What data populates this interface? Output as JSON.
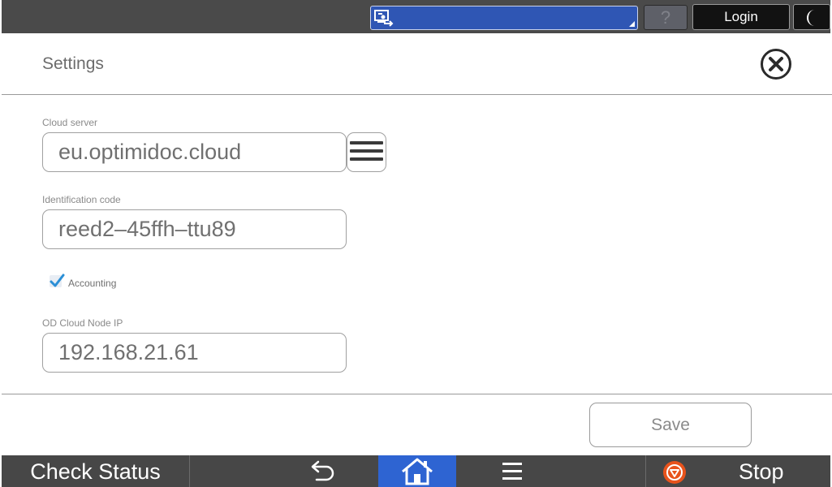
{
  "topbar": {
    "job_selector_icon": "device-transfer-icon",
    "help_label": "?",
    "login_label": "Login",
    "sleep_icon": "moon-icon"
  },
  "header": {
    "title": "Settings",
    "close_icon": "close-circle-icon"
  },
  "form": {
    "cloud_server": {
      "label": "Cloud server",
      "value": "eu.optimidoc.cloud",
      "menu_icon": "hamburger-menu-icon"
    },
    "identification_code": {
      "label": "Identification code",
      "value": "reed2–45ffh–ttu89"
    },
    "accounting": {
      "label": "Accounting",
      "checked": true
    },
    "node_ip": {
      "label": "OD Cloud Node IP",
      "value": "192.168.21.61"
    },
    "save_label": "Save"
  },
  "bottombar": {
    "check_status_label": "Check Status",
    "back_icon": "back-arrow-icon",
    "home_icon": "home-icon",
    "menu_icon": "menu-icon",
    "stop_icon": "stop-icon",
    "stop_label": "Stop"
  },
  "colors": {
    "topbar_bg": "#4a4a4a",
    "job_selector_bg": "#2f56b4",
    "home_active_bg": "#2e64d2",
    "stop_accent": "#e8531c",
    "checkbox_accent": "#2b8fd6"
  }
}
